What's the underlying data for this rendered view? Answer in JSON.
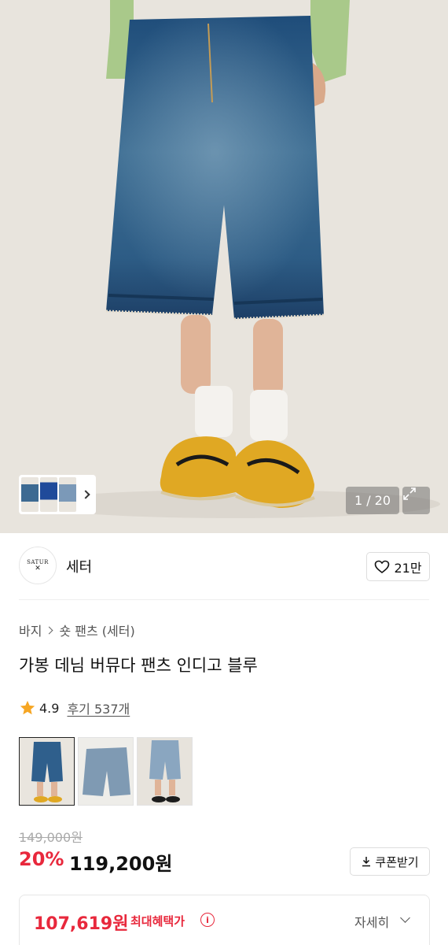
{
  "gallery": {
    "counter": "1 / 20",
    "image_alt": "denim bermuda shorts worn with yellow sneakers"
  },
  "brand": {
    "logo_text": "SATUR",
    "logo_mark": "✕",
    "name": "세터",
    "likes": "21만"
  },
  "breadcrumb": {
    "category": "바지",
    "subcategory": "숏 팬츠 (세터)"
  },
  "product": {
    "title": "가봉 데님 버뮤다 팬츠 인디고 블루",
    "rating": "4.9",
    "reviews": "후기 537개"
  },
  "price": {
    "original": "149,000원",
    "discount": "20%",
    "current": "119,200원",
    "coupon_label": "쿠폰받기"
  },
  "benefit": {
    "price": "107,619원",
    "label": "최대혜택가",
    "info_icon": "i",
    "detail_label": "자세히"
  },
  "colors": {
    "accent_red": "#e8283c",
    "star": "#f6a623"
  }
}
